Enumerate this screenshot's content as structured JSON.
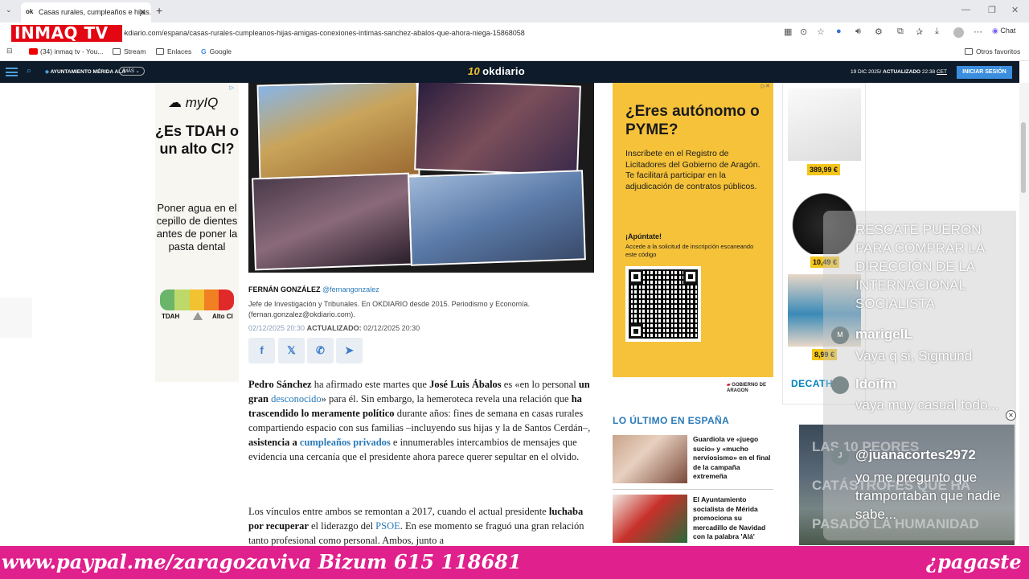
{
  "browser": {
    "tab_title": "Casas rurales, cumpleaños e hijas...",
    "tab_favicon": "ok",
    "url": "okdiario.com/espana/casas-rurales-cumpleanos-hijas-amigas-conexiones-intimas-sanchez-abalos-que-ahora-niega-15868058",
    "chat_label": "Chat",
    "bookmarks": [
      "(34) inmaq tv - You...",
      "Stream",
      "Enlaces",
      "Google"
    ],
    "other_favorites": "Otros favoritos"
  },
  "overlay_logo": "INMAQ TV",
  "site_header": {
    "topic": "AYUNTAMIENTO MÉRIDA ALÁ",
    "more": "MÁS",
    "brand": "okdiario",
    "brand_prefix": "10",
    "date": "19 DIC 2025/",
    "updated_label": "ACTUALIZADO",
    "updated_time": "22:38",
    "tz": "CET",
    "login": "INICIAR SESIÓN"
  },
  "ad_left": {
    "brand": "myIQ",
    "question": "¿Es TDAH o un alto CI?",
    "body": "Poner agua en el cepillo de dientes antes de poner la pasta dental",
    "label_low": "TDAH",
    "label_high": "Alto CI"
  },
  "article": {
    "author_name": "FERNÁN GONZÁLEZ",
    "author_handle": "@fernangonzalez",
    "bio": "Jefe de Investigación y Tribunales. En OKDIARIO desde 2015. Periodismo y Economía. (fernan.gonzalez@okdiario.com).",
    "published": "02/12/2025 20:30",
    "updated_label": "ACTUALIZADO:",
    "updated": "02/12/2025 20:30",
    "p1": {
      "s1": "Pedro Sánchez",
      "s2": " ha afirmado este martes que ",
      "s3": "José Luis Ábalos",
      "s4": " es «en lo personal ",
      "s5": "un gran",
      "s6": "desconocido",
      "s7": "» para él. Sin embargo, la hemeroteca revela una relación que ",
      "s8": "ha trascendido lo meramente político",
      "s9": " durante años: fines de semana en casas rurales compartiendo espacio con sus familias –incluyendo sus hijas y la de Santos Cerdán–, ",
      "s10": "asistencia a",
      "s11": "cumpleaños privados",
      "s12": " e innumerables intercambios de mensajes que evidencia una cercanía que el presidente ahora parece querer sepultar en el olvido."
    },
    "p2": {
      "s1": "Los vínculos entre ambos se remontan a 2017, cuando el actual presidente ",
      "s2": "luchaba por recuperar",
      "s3": " el liderazgo del ",
      "s4": "PSOE",
      "s5": ". En ese momento se fraguó una gran relación tanto profesional como personal. Ambos, junto a"
    }
  },
  "ad_mid": {
    "heading": "¿Eres autónomo o PYME?",
    "body": "Inscríbete en el Registro de Licitadores del Gobierno de Aragón. Te facilitará participar en la adjudicación de contratos públicos.",
    "cta": "¡Apúntate!",
    "cta_sub": "Accede a la solicitud de inscripción escaneando este código",
    "org": "GOBIERNO DE ARAGON"
  },
  "latest": {
    "title": "LO ÚLTIMO EN ESPAÑA",
    "items": [
      {
        "title": "Guardiola ve «juego sucio» y «mucho nerviosismo» en el final de la campaña extremeña"
      },
      {
        "title": "El Ayuntamiento socialista de Mérida promociona su mercadillo de Navidad con la palabra 'Alá'"
      }
    ]
  },
  "products": [
    {
      "price": "389,99 €"
    },
    {
      "price": "10,49 €"
    },
    {
      "price": "8,99 €"
    }
  ],
  "product_brand": "DECATH",
  "chat": {
    "prev_message": "RESCATE PUERON PARA COMPRAR LA DIRECCIÓN DE LA INTERNACIONAL SOCIALISTA",
    "messages": [
      {
        "user": "marigelL",
        "text": "Vaya q si, Sigmund",
        "avatar": "M"
      },
      {
        "user": "ldoifm",
        "text": "vaya muy casual todo...",
        "avatar": ""
      },
      {
        "user": "@juanacortes2972",
        "text": "yo me pregunto que tramportaban que nadie sabe...",
        "avatar": "J"
      }
    ]
  },
  "video_overlay": {
    "line1": "LAS 10 PEORES",
    "line2": "CATÁSTROFES QUE HA",
    "line3": "PASADO LA HUMANIDAD"
  },
  "ticker": {
    "left": "www.paypal.me/zaragozaviva Bizum 615 118681",
    "right": "¿pagaste tu"
  }
}
